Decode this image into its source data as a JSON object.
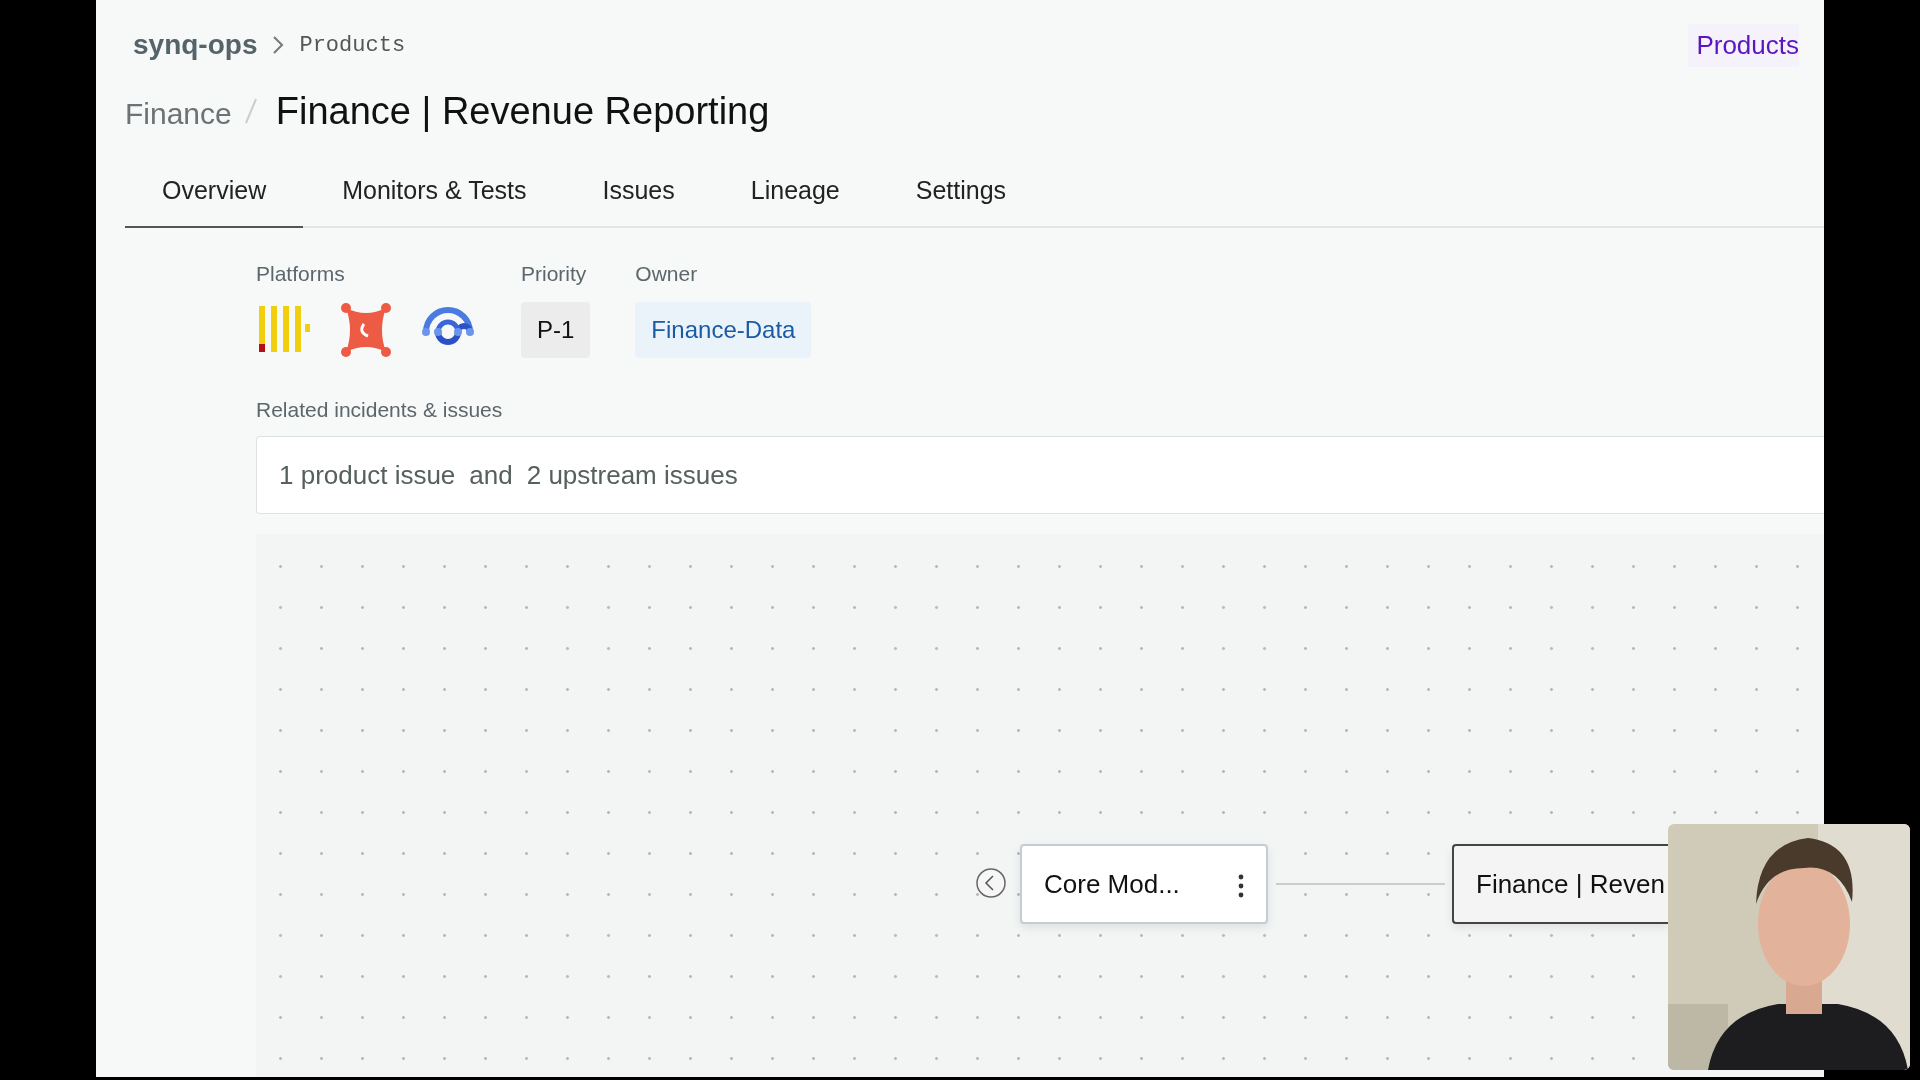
{
  "breadcrumb": {
    "workspace": "synq-ops",
    "current": "Products"
  },
  "header_link": "Products",
  "title": {
    "parent": "Finance",
    "name": "Finance | Revenue Reporting"
  },
  "tabs": [
    {
      "label": "Overview",
      "selected": true
    },
    {
      "label": "Monitors & Tests",
      "selected": false
    },
    {
      "label": "Issues",
      "selected": false
    },
    {
      "label": "Lineage",
      "selected": false
    },
    {
      "label": "Settings",
      "selected": false
    }
  ],
  "platforms": {
    "label": "Platforms"
  },
  "priority": {
    "label": "Priority",
    "value": "P-1"
  },
  "owner": {
    "label": "Owner",
    "value": "Finance-Data"
  },
  "related": {
    "label": "Related incidents & issues",
    "product_issues": "1 product issue",
    "joiner": "and",
    "upstream_issues": "2 upstream issues"
  },
  "lineage": {
    "nodes": [
      {
        "label": "Core Mod...",
        "kind": "upstream"
      },
      {
        "label": "Finance | Reven",
        "kind": "current"
      }
    ]
  }
}
